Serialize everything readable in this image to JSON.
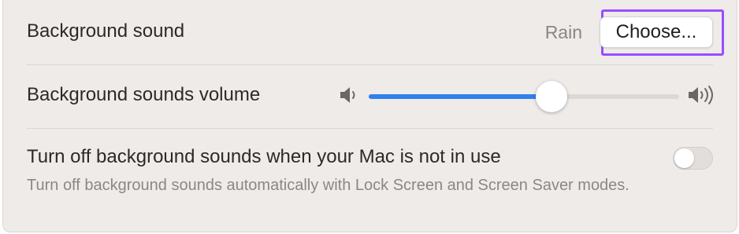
{
  "background_sound": {
    "label": "Background sound",
    "value": "Rain",
    "button_label": "Choose..."
  },
  "volume": {
    "label": "Background sounds volume",
    "level": 0.59,
    "low_icon": "speaker-low-icon",
    "high_icon": "speaker-high-icon"
  },
  "turn_off": {
    "label": "Turn off background sounds when your Mac is not in use",
    "description": "Turn off background sounds automatically with Lock Screen and Screen Saver modes.",
    "enabled": false
  },
  "colors": {
    "accent": "#2f80ed",
    "highlight": "#9b4dff",
    "panel": "#efebe9"
  }
}
